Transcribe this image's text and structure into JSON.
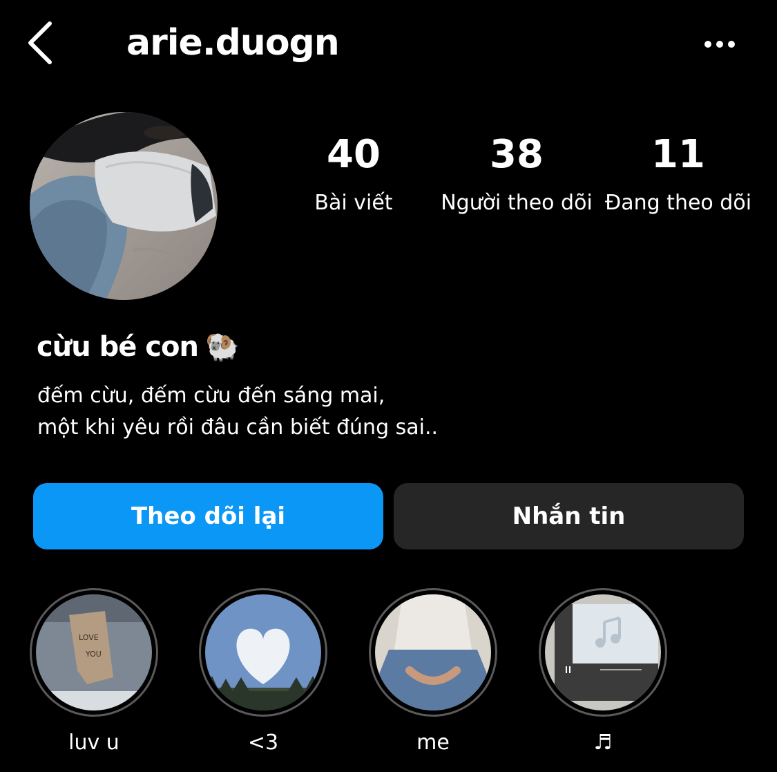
{
  "header": {
    "username": "arie.duogn",
    "back_icon": "chevron-left-icon",
    "more_icon": "more-horizontal-icon"
  },
  "stats": [
    {
      "value": "40",
      "label": "Bài viết"
    },
    {
      "value": "38",
      "label": "Người theo dõi"
    },
    {
      "value": "11",
      "label": "Đang theo dõi"
    }
  ],
  "profile": {
    "display_name": "cừu bé con",
    "display_name_emoji": "🐏",
    "bio_lines": [
      "đếm cừu, đếm cừu đến sáng mai,",
      "một khi yêu rồi đâu cần biết đúng sai.."
    ]
  },
  "actions": {
    "follow_back_label": "Theo dõi lại",
    "message_label": "Nhắn tin",
    "follow_color": "#0a97f6",
    "message_color": "#262626"
  },
  "highlights": [
    {
      "label": "luv u"
    },
    {
      "label": "<3"
    },
    {
      "label": "me"
    },
    {
      "label": "♬"
    }
  ]
}
